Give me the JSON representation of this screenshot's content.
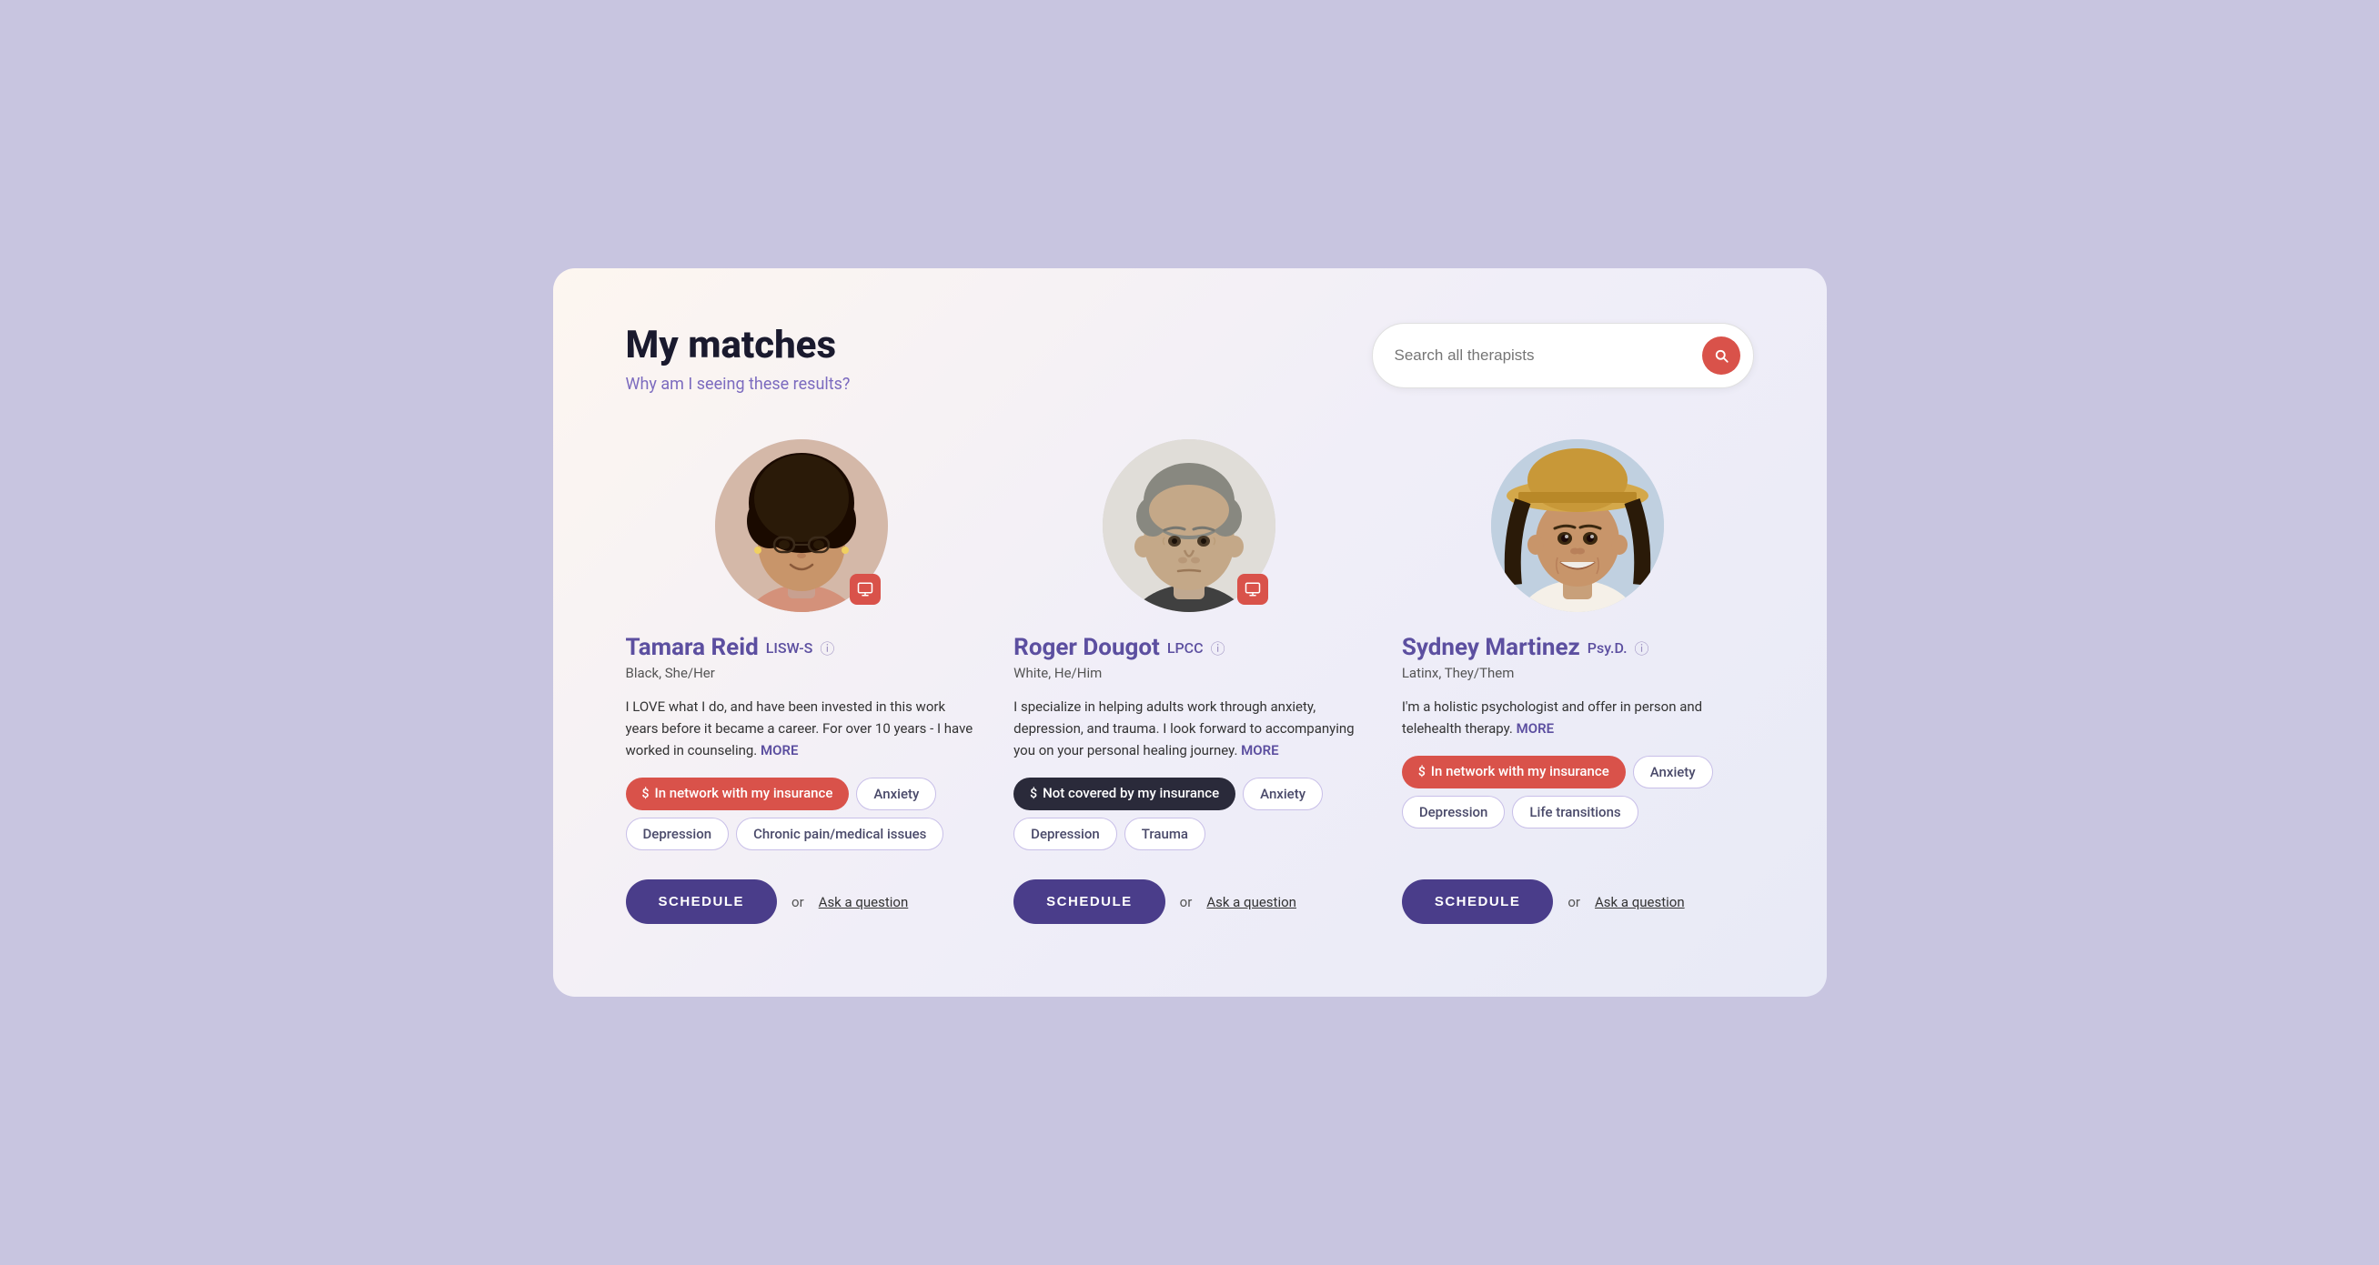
{
  "page": {
    "title": "My matches",
    "subtitle": "Why am I seeing these results?",
    "background_color": "#c8c5e0"
  },
  "search": {
    "placeholder": "Search all therapists",
    "button_label": "Search"
  },
  "therapists": [
    {
      "id": "tamara-reid",
      "name": "Tamara Reid",
      "credential": "LISW-S",
      "demographic": "Black, She/Her",
      "bio": "I LOVE what I do, and have been invested in this work years before it became a career. For over 10 years - I have worked in counseling.",
      "bio_more": "MORE",
      "insurance_tag": "In network with my insurance",
      "insurance_type": "network",
      "specialties": [
        "Anxiety",
        "Depression",
        "Chronic pain/medical issues"
      ],
      "schedule_label": "SCHEDULE",
      "ask_label": "Ask a question"
    },
    {
      "id": "roger-dougot",
      "name": "Roger Dougot",
      "credential": "LPCC",
      "demographic": "White, He/Him",
      "bio": "I specialize in helping adults work through anxiety, depression, and trauma. I look forward to accompanying you on your personal healing journey.",
      "bio_more": "MORE",
      "insurance_tag": "Not covered by my insurance",
      "insurance_type": "not-covered",
      "specialties": [
        "Anxiety",
        "Depression",
        "Trauma"
      ],
      "schedule_label": "SCHEDULE",
      "ask_label": "Ask a question"
    },
    {
      "id": "sydney-martinez",
      "name": "Sydney Martinez",
      "credential": "Psy.D.",
      "demographic": "Latinx, They/Them",
      "bio": "I'm a holistic psychologist and offer in person and telehealth therapy.",
      "bio_more": "MORE",
      "insurance_tag": "In network with my insurance",
      "insurance_type": "network",
      "specialties": [
        "Anxiety",
        "Depression",
        "Life transitions"
      ],
      "schedule_label": "SCHEDULE",
      "ask_label": "Ask a question"
    }
  ]
}
